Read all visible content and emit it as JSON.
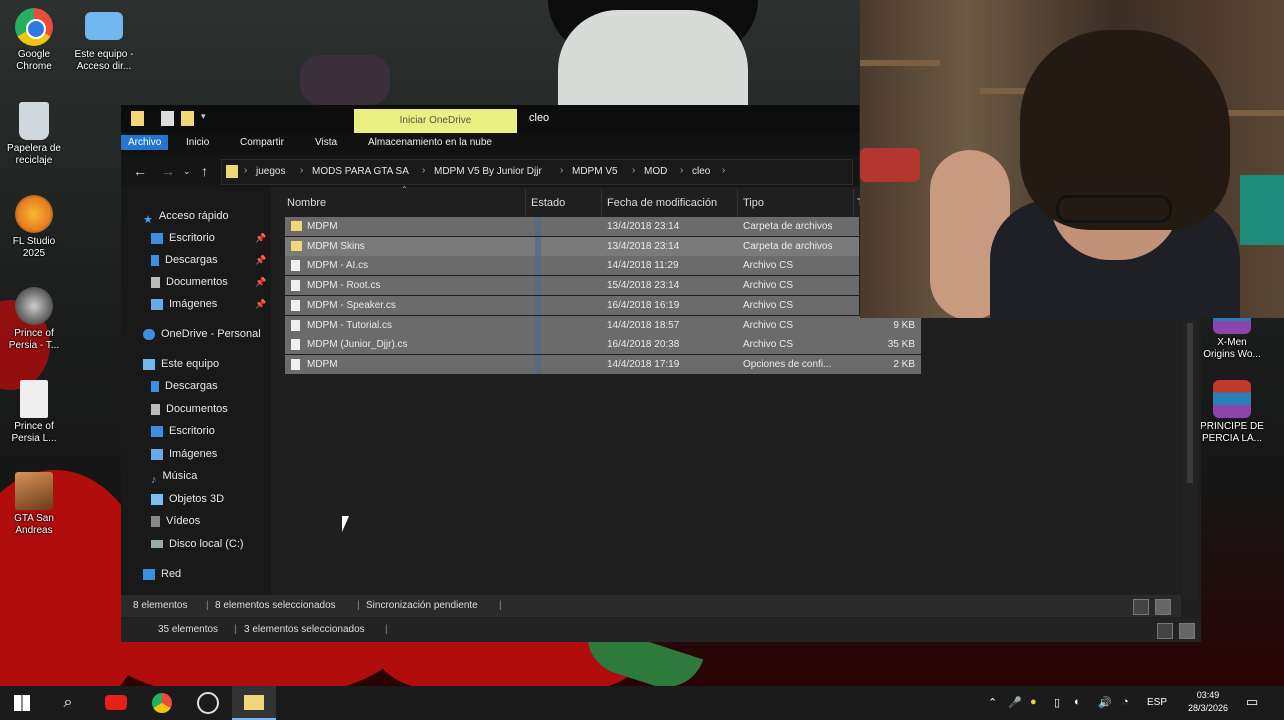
{
  "desktop": {
    "icons_left": [
      {
        "label1": "Google",
        "label2": "Chrome",
        "icon": "chrome-icon",
        "color": "#e74c3c"
      },
      {
        "label1": "Este equipo -",
        "label2": "Acceso dir...",
        "icon": "computer-icon",
        "color": "#6fb7ee"
      },
      {
        "label1": "Papelera de",
        "label2": "reciclaje",
        "icon": "recycle-bin-icon",
        "color": "#cfd8dc"
      },
      {
        "label1": "FL Studio",
        "label2": "2025",
        "icon": "fl-studio-icon",
        "color": "#f39c12"
      },
      {
        "label1": "Prince of",
        "label2": "Persia - T...",
        "icon": "prince-of-persia-icon",
        "color": "#7f7f7f"
      },
      {
        "label1": "Prince of",
        "label2": "Persia L...",
        "icon": "document-icon",
        "color": "#eeeeee"
      },
      {
        "label1": "GTA San",
        "label2": "Andreas",
        "icon": "gta-icon",
        "color": "#b8733a"
      }
    ],
    "icons_right": [
      {
        "label1": "X-Men",
        "label2": "Origins Wo...",
        "icon": "winrar-icon",
        "color": "#c0392b"
      },
      {
        "label1": "PRINCIPE DE",
        "label2": "PERCIA LA...",
        "icon": "winrar-icon",
        "color": "#c0392b"
      }
    ]
  },
  "explorer": {
    "title": "cleo",
    "onedrive_button": "Iniciar OneDrive",
    "ribbon_tabs": [
      "Archivo",
      "Inicio",
      "Compartir",
      "Vista",
      "Almacenamiento en la nube"
    ],
    "breadcrumb": [
      "juegos",
      "MODS PARA GTA SA",
      "MDPM V5 By Junior Djjr",
      "MDPM V5",
      "MOD",
      "cleo"
    ],
    "nav": {
      "quick_access": "Acceso rápido",
      "quick_items": [
        "Escritorio",
        "Descargas",
        "Documentos",
        "Imágenes"
      ],
      "onedrive": "OneDrive - Personal",
      "this_pc": "Este equipo",
      "pc_items": [
        "Descargas",
        "Documentos",
        "Escritorio",
        "Imágenes",
        "Música",
        "Objetos 3D",
        "Vídeos",
        "Disco local (C:)"
      ],
      "network": "Red"
    },
    "columns": [
      "Nombre",
      "Estado",
      "Fecha de modificación",
      "Tipo",
      "T"
    ],
    "files": [
      {
        "name": "MDPM",
        "date": "13/4/2018 23:14",
        "type": "Carpeta de archivos",
        "size": "",
        "kind": "folder"
      },
      {
        "name": "MDPM Skins",
        "date": "13/4/2018 23:14",
        "type": "Carpeta de archivos",
        "size": "",
        "kind": "folder"
      },
      {
        "name": "MDPM - AI.cs",
        "date": "14/4/2018 11:29",
        "type": "Archivo CS",
        "size": "",
        "kind": "file"
      },
      {
        "name": "MDPM - Root.cs",
        "date": "15/4/2018 23:14",
        "type": "Archivo CS",
        "size": "",
        "kind": "file"
      },
      {
        "name": "MDPM - Speaker.cs",
        "date": "16/4/2018 16:19",
        "type": "Archivo CS",
        "size": "",
        "kind": "file"
      },
      {
        "name": "MDPM - Tutorial.cs",
        "date": "14/4/2018 18:57",
        "type": "Archivo CS",
        "size": "9 KB",
        "kind": "file"
      },
      {
        "name": "MDPM (Junior_Djjr).cs",
        "date": "16/4/2018 20:38",
        "type": "Archivo CS",
        "size": "35 KB",
        "kind": "file"
      },
      {
        "name": "MDPM",
        "date": "14/4/2018 17:19",
        "type": "Opciones de confi...",
        "size": "2 KB",
        "kind": "file"
      }
    ],
    "status_front": {
      "count": "8 elementos",
      "selected": "8 elementos seleccionados",
      "sync": "Sincronización pendiente"
    },
    "status_back": {
      "count": "35 elementos",
      "selected": "3 elementos seleccionados"
    }
  },
  "taskbar": {
    "apps": [
      "start-icon",
      "search-icon",
      "youtube-icon",
      "chrome-icon",
      "app-icon",
      "file-explorer-icon"
    ],
    "language": "ESP",
    "time": "03:49",
    "date": "28/3/2026"
  }
}
